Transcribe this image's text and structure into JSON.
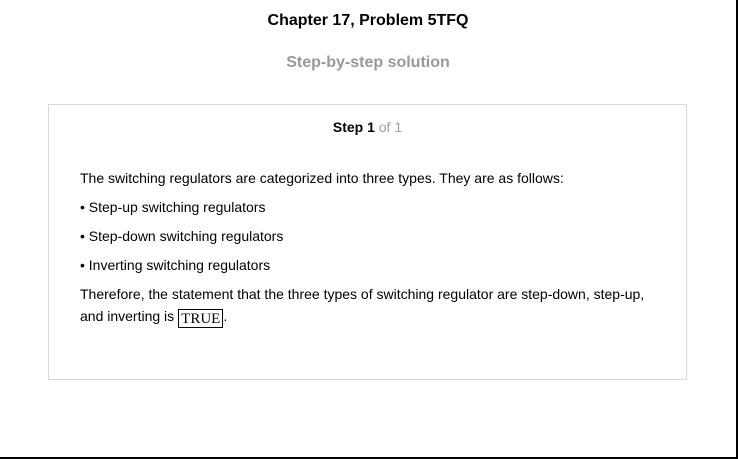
{
  "header": {
    "chapter_title": "Chapter 17, Problem 5TFQ",
    "sub_title": "Step-by-step solution"
  },
  "step": {
    "label": "Step 1",
    "of_text": " of 1"
  },
  "content": {
    "intro": "The switching regulators are categorized into three types. They are as follows:",
    "bullets": [
      "• Step-up switching regulators",
      "• Step-down switching regulators",
      "• Inverting switching regulators"
    ],
    "conclusion_lead": "Therefore, the statement that the three types of switching regulator are step-down, step-up, and inverting is",
    "answer": "TRUE",
    "conclusion_end": "."
  }
}
